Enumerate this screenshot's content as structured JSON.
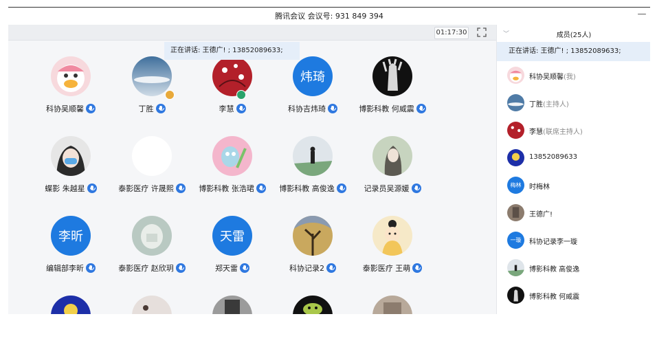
{
  "window": {
    "title": "腾讯会议 会议号: 931 849 394",
    "minimize_glyph": "—"
  },
  "toolbar": {
    "timer": "01:17:30"
  },
  "speaking_banner": "正在讲话: 王德广! ; 13852089633;",
  "participants": [
    {
      "name": "科协吴顺馨"
    },
    {
      "name": "丁胜"
    },
    {
      "name": "李慧"
    },
    {
      "name": "科协吉炜琦",
      "avatar_text": "炜琦"
    },
    {
      "name": "博影科教 何威震"
    },
    {
      "name": "蝶影 朱越星"
    },
    {
      "name": "泰影医疗 许晟熙"
    },
    {
      "name": "博影科教 张浩珺"
    },
    {
      "name": "博影科教 高俊逸"
    },
    {
      "name": "记录员吴源媛"
    },
    {
      "name": "编辑部李昕",
      "avatar_text": "李昕"
    },
    {
      "name": "泰影医疗 赵欣玥"
    },
    {
      "name": "郑天雷",
      "avatar_text": "天雷"
    },
    {
      "name": "科协记录2"
    },
    {
      "name": "泰影医疗 王萌"
    }
  ],
  "sidebar": {
    "header": "成员(25人)",
    "speaking": "正在讲话: 王德广! ; 13852089633;",
    "members": [
      {
        "name": "科协吴顺馨",
        "role": "(我)"
      },
      {
        "name": "丁胜",
        "role": "(主持人)"
      },
      {
        "name": "李慧",
        "role": "(联席主持人)"
      },
      {
        "name": "13852089633",
        "role": ""
      },
      {
        "name": "时梅林",
        "role": "",
        "avatar_text": "梅林"
      },
      {
        "name": "王德广!",
        "role": ""
      },
      {
        "name": "科协记录李一璇",
        "role": "",
        "avatar_text": "一璇"
      },
      {
        "name": "博影科教 高俊逸",
        "role": ""
      },
      {
        "name": "博影科教 何威震",
        "role": ""
      }
    ]
  },
  "colors": {
    "accent": "#1e7ae0",
    "speaking_bg": "#e5eef9",
    "host_badge": "#e8a93a",
    "cohost_badge": "#2aa36b"
  }
}
